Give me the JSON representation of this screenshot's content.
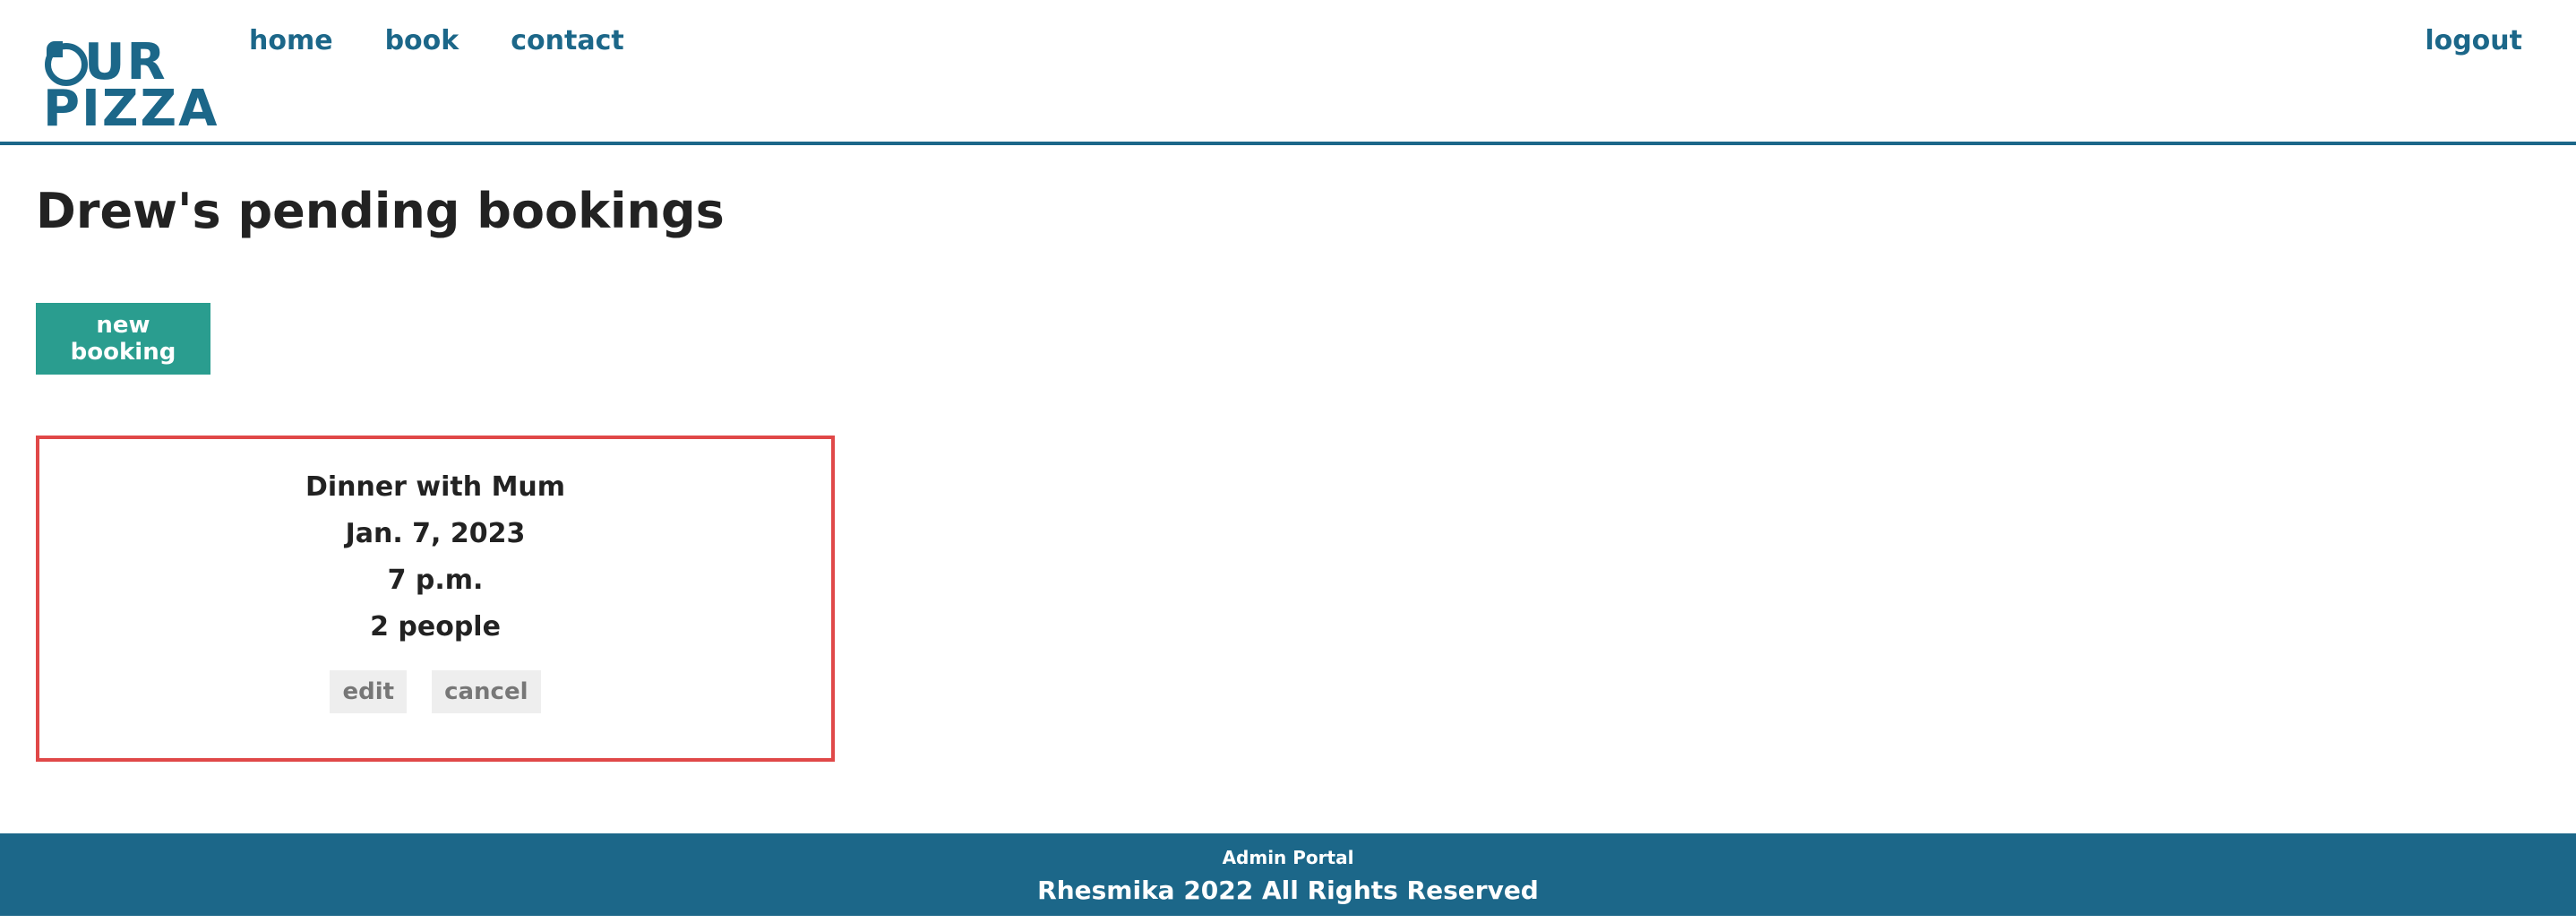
{
  "header": {
    "logo": {
      "line1": "UR",
      "line2": "PIZZA"
    },
    "nav": {
      "home": "home",
      "book": "book",
      "contact": "contact"
    },
    "logout": "logout"
  },
  "main": {
    "title": "Drew's pending bookings",
    "new_booking_label": "new booking",
    "bookings": [
      {
        "name": "Dinner with Mum",
        "date": "Jan. 7, 2023",
        "time": "7 p.m.",
        "people": "2 people",
        "edit_label": "edit",
        "cancel_label": "cancel"
      }
    ]
  },
  "footer": {
    "portal": "Admin Portal",
    "copyright": "Rhesmika 2022 All Rights Reserved"
  },
  "colors": {
    "brand": "#1c6789",
    "accent": "#2a9d8f",
    "card_border": "#e04848"
  }
}
